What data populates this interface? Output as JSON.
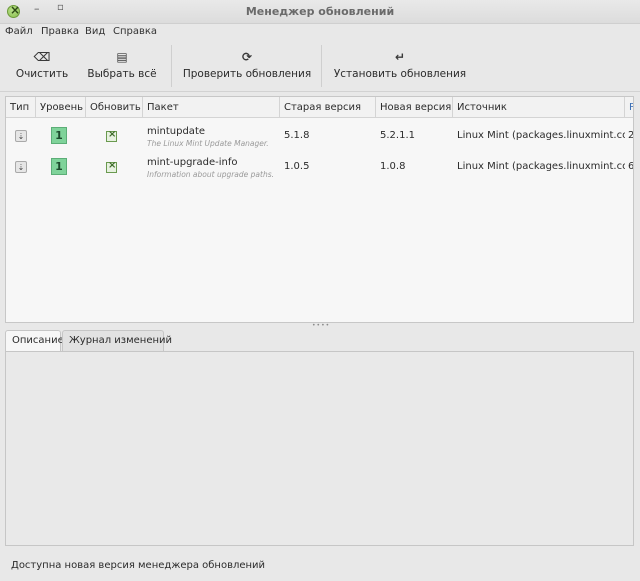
{
  "window": {
    "title": "Менеджер обновлений"
  },
  "menubar": {
    "items": [
      "Файл",
      "Правка",
      "Вид",
      "Справка"
    ]
  },
  "toolbar": {
    "clear": {
      "label": "Очистить",
      "icon": "backspace-icon",
      "glyph": "⌫"
    },
    "select_all": {
      "label": "Выбрать всё",
      "icon": "document-icon",
      "glyph": "▤"
    },
    "check_updates": {
      "label": "Проверить обновления",
      "icon": "refresh-icon",
      "glyph": "⟳"
    },
    "install_updates": {
      "label": "Установить обновления",
      "icon": "enter-icon",
      "glyph": "↵"
    }
  },
  "table": {
    "columns": [
      "Тип",
      "Уровень",
      "Обновить",
      "Пакет",
      "Старая версия",
      "Новая версия",
      "Источник",
      "Р"
    ],
    "rows": [
      {
        "type_icon": "package-update-icon",
        "level": "1",
        "update_checked": true,
        "package": "mintupdate",
        "description": "The Linux Mint Update Manager.",
        "old_version": "5.1.8",
        "new_version": "5.2.1.1",
        "source": "Linux Mint (packages.linuxmint.com)",
        "extra": "2"
      },
      {
        "type_icon": "package-update-icon",
        "level": "1",
        "update_checked": true,
        "package": "mint-upgrade-info",
        "description": "Information about upgrade paths.",
        "old_version": "1.0.5",
        "new_version": "1.0.8",
        "source": "Linux Mint (packages.linuxmint.com)",
        "extra": "6"
      }
    ]
  },
  "tabs": [
    {
      "label": "Описание",
      "active": true
    },
    {
      "label": "Журнал изменений",
      "active": false
    }
  ],
  "status": {
    "text": "Доступна новая версия менеджера обновлений"
  },
  "colors": {
    "level_badge": "#7fd39a",
    "checkbox_check": "#3d6a28",
    "close_button": "#8cbf4f"
  }
}
